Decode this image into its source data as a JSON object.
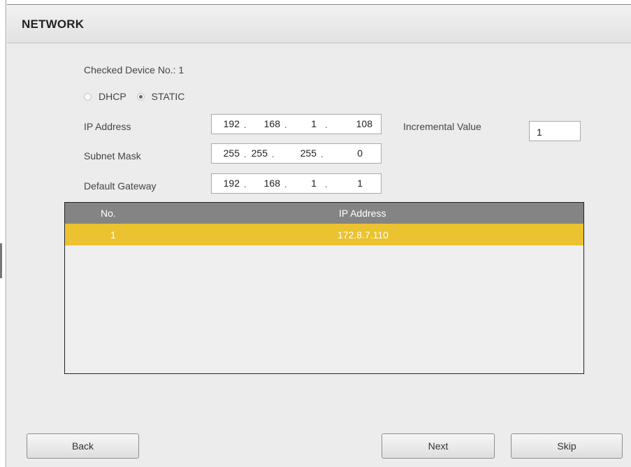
{
  "dialog": {
    "title": "NETWORK"
  },
  "device": {
    "checked_label": "Checked Device No.:",
    "checked_value": "1"
  },
  "mode": {
    "dhcp_label": "DHCP",
    "static_label": "STATIC",
    "selected": "STATIC"
  },
  "fields": {
    "ip_label": "IP Address",
    "ip": [
      "192",
      "168",
      "1",
      "108"
    ],
    "subnet_label": "Subnet Mask",
    "subnet": [
      "255",
      "255",
      "255",
      "0"
    ],
    "gateway_label": "Default Gateway",
    "gateway": [
      "192",
      "168",
      "1",
      "1"
    ],
    "incremental_label": "Incremental Value",
    "incremental_value": "1"
  },
  "table": {
    "headers": [
      "No.",
      "IP Address"
    ],
    "rows": [
      {
        "no": "1",
        "ip": "172.8.7.110"
      }
    ]
  },
  "buttons": {
    "back": "Back",
    "next": "Next",
    "skip": "Skip"
  },
  "colors": {
    "header": "#848484",
    "selected_row": "#ebc22f",
    "panel": "#ececec"
  }
}
